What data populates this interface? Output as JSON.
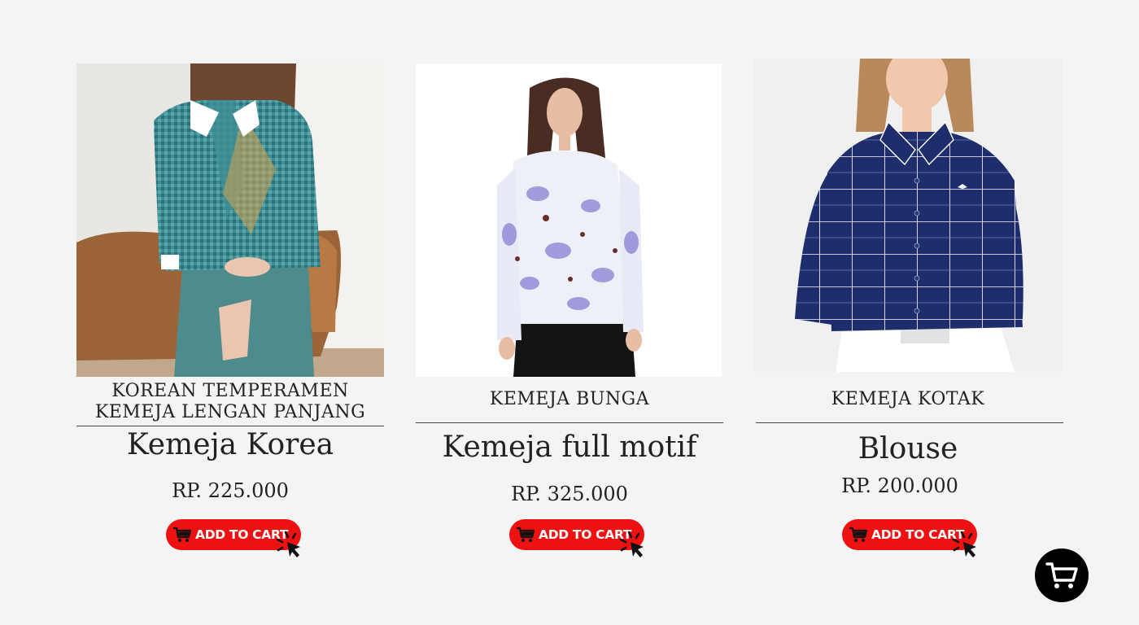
{
  "products": [
    {
      "subtitle_line1": "KOREAN TEMPERAMEN",
      "subtitle_line2": "KEMEJA LENGAN PANJANG",
      "name": "Kemeja Korea",
      "price": "RP. 225.000",
      "button_label": "ADD TO CART",
      "shirt_color": "#3e8f95"
    },
    {
      "subtitle_line1": "KEMEJA BUNGA",
      "subtitle_line2": "",
      "name": "Kemeja full motif",
      "price": "RP. 325.000",
      "button_label": "ADD TO CART",
      "shirt_color": "#eef0f8"
    },
    {
      "subtitle_line1": "KEMEJA KOTAK",
      "subtitle_line2": "",
      "name": "Blouse",
      "price": "RP. 200.000",
      "button_label": "ADD TO CART",
      "shirt_color": "#1e2d6b"
    }
  ],
  "icons": {
    "button_cart": "shopping-cart-icon",
    "button_pointer": "click-pointer-icon",
    "floating_cart": "shopping-cart-icon"
  },
  "colors": {
    "background": "#f4f4f4",
    "button": "#ee1111",
    "button_text": "#ffffff",
    "floating_cart_bg": "#000000"
  }
}
